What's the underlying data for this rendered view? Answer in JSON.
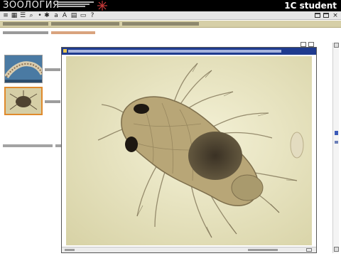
{
  "app": {
    "logo_title": "ЗООЛОГИЯ",
    "brand": "1C student"
  },
  "breadcrumb": {
    "items": [
      "",
      "",
      ""
    ]
  },
  "left_panel": {
    "heading_left": "",
    "heading_right": "",
    "thumbnails": [
      {
        "label": ""
      },
      {
        "label": ""
      }
    ],
    "bottom_label": ""
  },
  "viewer": {
    "title": "",
    "status_left": "",
    "status_right": ""
  },
  "colors": {
    "banner_bg": "#000000",
    "crumbbar_bg": "#d6cfa7",
    "viewer_title_bg": "#1f3b8f",
    "selected_thumb_border": "#e08a2c",
    "image_bg": "#efecc8"
  },
  "icons": [
    "toolbar-icons",
    "window-icon",
    "scroll-up-icon",
    "scroll-down-icon"
  ]
}
